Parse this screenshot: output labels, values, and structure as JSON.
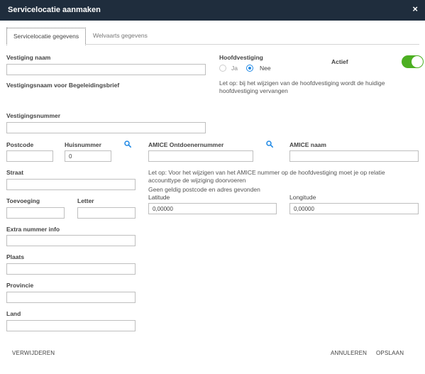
{
  "dialog": {
    "title": "Servicelocatie aanmaken",
    "close_label": "×"
  },
  "tabs": [
    {
      "label": "Servicelocatie gegevens",
      "active": true
    },
    {
      "label": "Welvaarts gegevens",
      "active": false
    }
  ],
  "form": {
    "vestiging_naam": {
      "label": "Vestiging naam",
      "value": ""
    },
    "vestigingsnaam_brief": {
      "label": "Vestigingsnaam voor Begeleidingsbrief"
    },
    "hoofdvestiging": {
      "label": "Hoofdvestiging",
      "options": [
        {
          "label": "Ja",
          "selected": false
        },
        {
          "label": "Nee",
          "selected": true
        }
      ],
      "note": "Let op: bij het wijzigen van de hoofdvestiging wordt de huidige hoofdvestiging vervangen"
    },
    "actief": {
      "label": "Actief",
      "on": true
    },
    "vestigingsnummer": {
      "label": "Vestigingsnummer",
      "value": ""
    },
    "postcode": {
      "label": "Postcode",
      "value": ""
    },
    "huisnummer": {
      "label": "Huisnummer",
      "value": "0"
    },
    "amice_ontdoenernummer": {
      "label": "AMICE Ontdoenernummer",
      "value": ""
    },
    "amice_naam": {
      "label": "AMICE naam",
      "value": ""
    },
    "straat": {
      "label": "Straat",
      "value": ""
    },
    "amice_note": "Let op: Voor het wijzigen van het AMICE nummer op de hoofdvestiging moet je op relatie accounttype de wijziging doorvoeren",
    "address_note": "Geen geldig postcode en adres gevonden",
    "latitude": {
      "label": "Latitude",
      "value": "0,00000"
    },
    "longitude": {
      "label": "Longitude",
      "value": "0,00000"
    },
    "toevoeging": {
      "label": "Toevoeging",
      "value": ""
    },
    "letter": {
      "label": "Letter",
      "value": ""
    },
    "extra_nummer_info": {
      "label": "Extra nummer info",
      "value": ""
    },
    "plaats": {
      "label": "Plaats",
      "value": ""
    },
    "provincie": {
      "label": "Provincie",
      "value": ""
    },
    "land": {
      "label": "Land",
      "value": ""
    }
  },
  "footer": {
    "delete_label": "VERWIJDEREN",
    "cancel_label": "ANNULEREN",
    "save_label": "OPSLAAN"
  },
  "colors": {
    "header_bg": "#1f2d3d",
    "accent": "#1e88e5",
    "toggle_on": "#4caf22"
  }
}
